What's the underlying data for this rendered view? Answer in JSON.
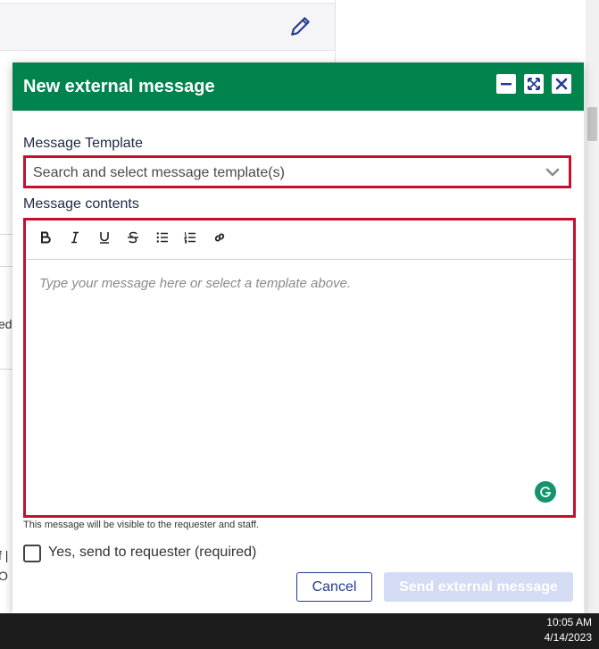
{
  "background": {
    "frag_ed": "ed",
    "frag_f": "f |",
    "frag_o": "O"
  },
  "dialog": {
    "title": "New external message",
    "template_label": "Message Template",
    "template_placeholder": "Search and select message template(s)",
    "contents_label": "Message contents",
    "editor_placeholder": "Type your message here or select a template above.",
    "toolbar": [
      "bold",
      "italic",
      "underline",
      "strikethrough",
      "bullet-list",
      "numbered-list",
      "link"
    ],
    "help_text": "This message will be visible to the requester and staff.",
    "checkbox_label": "Yes, send to requester (required)",
    "cancel_label": "Cancel",
    "send_label": "Send external message"
  },
  "colors": {
    "header": "#00834d",
    "required_border": "#c3102f",
    "primary": "#233c8f",
    "disabled": "#d3dbf5"
  },
  "taskbar": {
    "time": "10:05 AM",
    "date": "4/14/2023"
  }
}
